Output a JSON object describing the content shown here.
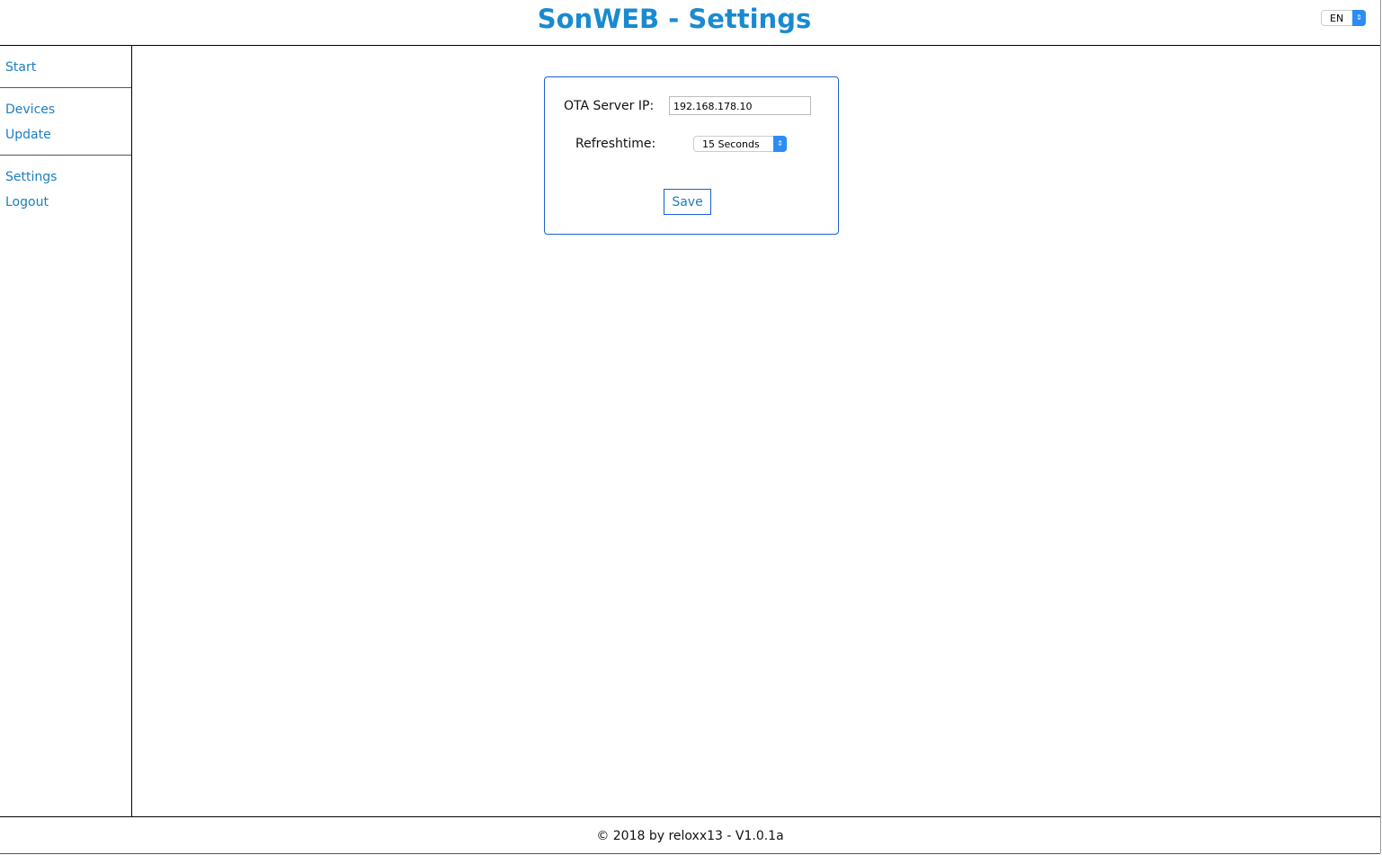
{
  "header": {
    "title": "SonWEB - Settings",
    "language": "EN"
  },
  "sidebar": {
    "groups": [
      [
        {
          "label": "Start"
        }
      ],
      [
        {
          "label": "Devices"
        },
        {
          "label": "Update"
        }
      ],
      [
        {
          "label": "Settings"
        },
        {
          "label": "Logout"
        }
      ]
    ]
  },
  "settings": {
    "ota_label": "OTA Server IP:",
    "ota_value": "192.168.178.10",
    "refresh_label": "Refreshtime:",
    "refresh_value": "15 Seconds",
    "save_label": "Save"
  },
  "footer": {
    "text": "© 2018 by reloxx13 - V1.0.1a"
  }
}
